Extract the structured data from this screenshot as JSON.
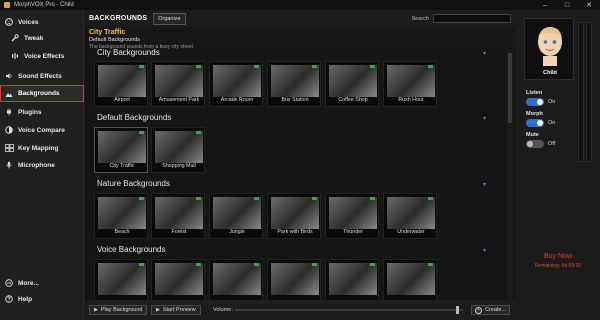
{
  "window": {
    "title": "MorphVOX Pro - Child",
    "min": "–",
    "max": "□",
    "close": "✕"
  },
  "sidebar": {
    "items": [
      {
        "label": "Voices"
      },
      {
        "label": "Tweak"
      },
      {
        "label": "Voice Effects"
      },
      {
        "label": "Sound Effects"
      },
      {
        "label": "Backgrounds"
      },
      {
        "label": "Plugins"
      },
      {
        "label": "Voice Compare"
      },
      {
        "label": "Key Mapping"
      },
      {
        "label": "Microphone"
      },
      {
        "label": "More..."
      },
      {
        "label": "Help"
      }
    ]
  },
  "toolbar": {
    "heading": "BACKGROUNDS",
    "organize_label": "Organize",
    "search_label": "Search",
    "search_value": ""
  },
  "info": {
    "title": "City Traffic",
    "category": "Default Backgrounds",
    "description": "The background sounds from a busy city street"
  },
  "sections": [
    {
      "title": "City Backgrounds",
      "items": [
        "Airport",
        "Amusement Park",
        "Arcade Room",
        "Bus Station",
        "Coffee Shop",
        "Rush Hour"
      ]
    },
    {
      "title": "Default Backgrounds",
      "items": [
        "City Traffic",
        "Shopping Mall"
      ]
    },
    {
      "title": "Nature Backgrounds",
      "items": [
        "Beach",
        "Forest",
        "Jungle",
        "Park with Birds",
        "Thunder",
        "Underwater"
      ]
    },
    {
      "title": "Voice Backgrounds",
      "items": [
        "",
        "",
        "",
        "",
        "",
        ""
      ]
    }
  ],
  "bottom": {
    "play_label": "Play Background",
    "preview_label": "Start Preview",
    "volume_label": "Volume:",
    "create_label": "Create...",
    "volume_level": 0.97
  },
  "voice": {
    "name": "Child",
    "listen_label": "Listen",
    "listen_state": "On",
    "morph_label": "Morph",
    "morph_state": "On",
    "mute_label": "Mute",
    "mute_state": "Off"
  },
  "promo": {
    "buy_label": "Buy Now",
    "remaining": "Remaining: 6d 09:30"
  },
  "colors": {
    "accent_blue": "#2f6fd1",
    "selected_title": "#f0c44a",
    "active_outline": "#e23636",
    "buy_red": "#e0392b"
  }
}
